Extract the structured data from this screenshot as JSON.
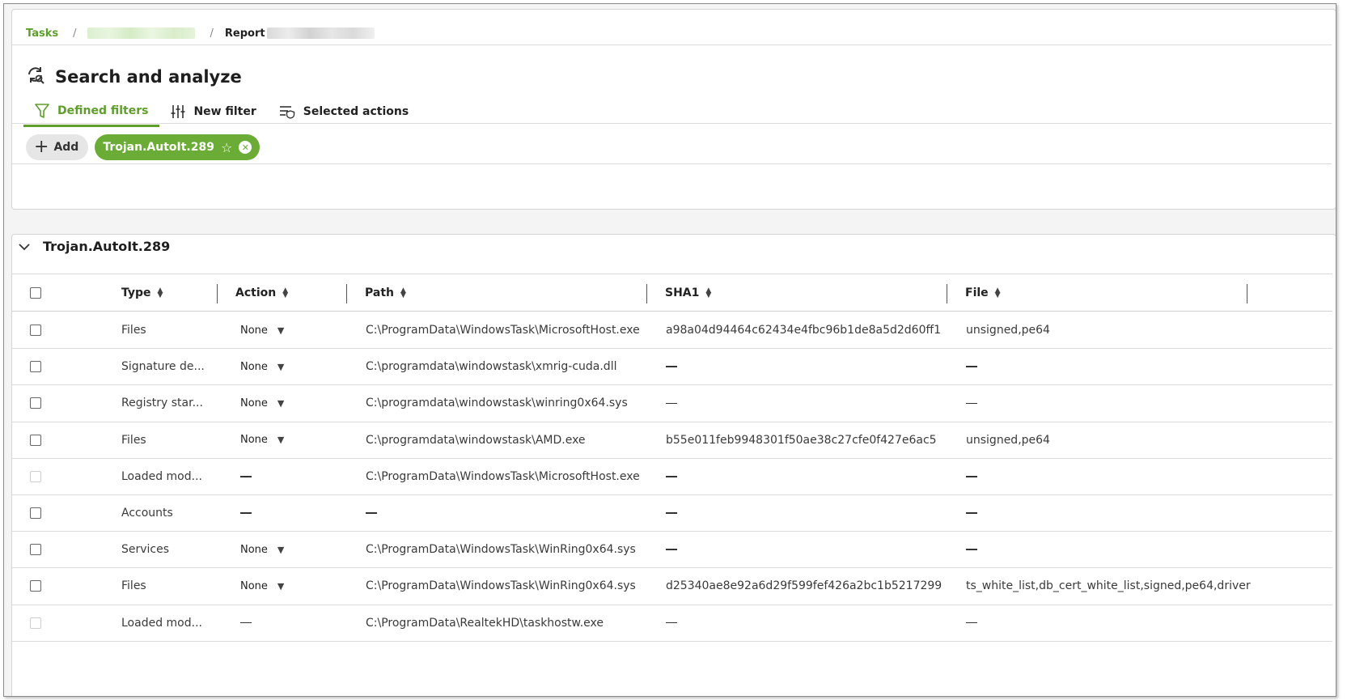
{
  "breadcrumb": {
    "tasks_label": "Tasks",
    "report_label": "Report"
  },
  "header": {
    "title": "Search and analyze",
    "tabs": [
      {
        "label": "Defined filters",
        "icon": "funnel-icon",
        "active": true
      },
      {
        "label": "New filter",
        "icon": "sliders-icon",
        "active": false
      },
      {
        "label": "Selected actions",
        "icon": "list-shield-icon",
        "active": false
      }
    ]
  },
  "filters": {
    "add_label": "Add",
    "active_filter": "Trojan.AutoIt.289"
  },
  "section": {
    "title": "Trojan.AutoIt.289"
  },
  "table": {
    "columns": [
      "Type",
      "Action",
      "Path",
      "SHA1",
      "File"
    ],
    "rows": [
      {
        "type": "Files",
        "action": "None",
        "path": "C:\\ProgramData\\WindowsTask\\MicrosoftHost.exe",
        "sha1": "a98a04d94464c62434e4fbc96b1de8a5d2d60ff1",
        "file": "unsigned,pe64",
        "disabled": false
      },
      {
        "type": "Signature de...",
        "action": "None",
        "path": "C:\\programdata\\windowstask\\xmrig-cuda.dll",
        "sha1": "",
        "file": "",
        "disabled": false
      },
      {
        "type": "Registry star...",
        "action": "None",
        "path": "C:\\programdata\\windowstask\\winring0x64.sys",
        "sha1": "",
        "file": "",
        "disabled": false
      },
      {
        "type": "Files",
        "action": "None",
        "path": "C:\\programdata\\windowstask\\AMD.exe",
        "sha1": "b55e011feb9948301f50ae38c27cfe0f427e6ac5",
        "file": "unsigned,pe64",
        "disabled": false
      },
      {
        "type": "Loaded mod...",
        "action": "",
        "path": "C:\\ProgramData\\WindowsTask\\MicrosoftHost.exe",
        "sha1": "",
        "file": "",
        "disabled": true
      },
      {
        "type": "Accounts",
        "action": "",
        "path": "",
        "sha1": "",
        "file": "",
        "disabled": false
      },
      {
        "type": "Services",
        "action": "None",
        "path": "C:\\ProgramData\\WindowsTask\\WinRing0x64.sys",
        "sha1": "",
        "file": "",
        "disabled": false
      },
      {
        "type": "Files",
        "action": "None",
        "path": "C:\\ProgramData\\WindowsTask\\WinRing0x64.sys",
        "sha1": "d25340ae8e92a6d29f599fef426a2bc1b5217299",
        "file": "ts_white_list,db_cert_white_list,signed,pe64,driver",
        "disabled": false
      },
      {
        "type": "Loaded mod...",
        "action": "",
        "path": "C:\\ProgramData\\RealtekHD\\taskhostw.exe",
        "sha1": "",
        "file": "",
        "disabled": true
      }
    ]
  },
  "colors": {
    "accent": "#5f9e2c",
    "chip": "#6aac36"
  }
}
